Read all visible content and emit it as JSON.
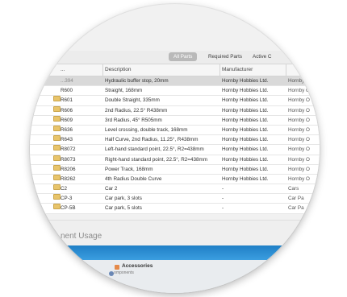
{
  "toolbar": {
    "segments": [
      {
        "label": "All Parts",
        "active": true
      },
      {
        "label": "Required Parts",
        "active": false
      },
      {
        "label": "Active C",
        "active": false
      }
    ]
  },
  "table": {
    "headers": [
      "...",
      "Description",
      "Manufacturer",
      ""
    ],
    "rows": [
      {
        "part": "...394",
        "description": "Hydraulic buffer stop, 20mm",
        "manufacturer": "Hornby Hobbies Ltd.",
        "category": "Hornby",
        "selected": true,
        "folder": false
      },
      {
        "part": "R600",
        "description": "Straight, 168mm",
        "manufacturer": "Hornby Hobbies Ltd.",
        "category": "Hornby O",
        "selected": false,
        "folder": false
      },
      {
        "part": "R601",
        "description": "Double Straight, 335mm",
        "manufacturer": "Hornby Hobbies Ltd.",
        "category": "Hornby O",
        "selected": false,
        "folder": true
      },
      {
        "part": "R606",
        "description": "2nd Radius, 22.5° R438mm",
        "manufacturer": "Hornby Hobbies Ltd.",
        "category": "Hornby O",
        "selected": false,
        "folder": true
      },
      {
        "part": "R609",
        "description": "3rd Radius, 45° R505mm",
        "manufacturer": "Hornby Hobbies Ltd.",
        "category": "Hornby O",
        "selected": false,
        "folder": true
      },
      {
        "part": "R636",
        "description": "Level crossing, double track, 168mm",
        "manufacturer": "Hornby Hobbies Ltd.",
        "category": "Hornby O",
        "selected": false,
        "folder": true
      },
      {
        "part": "R643",
        "description": "Half Curve, 2nd Radius, 11.25°, R438mm",
        "manufacturer": "Hornby Hobbies Ltd.",
        "category": "Hornby O",
        "selected": false,
        "folder": true
      },
      {
        "part": "R8072",
        "description": "Left-hand standard point, 22.5°, R2=438mm",
        "manufacturer": "Hornby Hobbies Ltd.",
        "category": "Hornby O",
        "selected": false,
        "folder": true
      },
      {
        "part": "R8073",
        "description": "Right-hand standard point, 22.5°, R2=438mm",
        "manufacturer": "Hornby Hobbies Ltd.",
        "category": "Hornby O",
        "selected": false,
        "folder": true
      },
      {
        "part": "R8206",
        "description": "Power Track, 168mm",
        "manufacturer": "Hornby Hobbies Ltd.",
        "category": "Hornby O",
        "selected": false,
        "folder": true
      },
      {
        "part": "R8262",
        "description": "4th Radius Double Curve",
        "manufacturer": "Hornby Hobbies Ltd.",
        "category": "Hornby O",
        "selected": false,
        "folder": true
      },
      {
        "part": "C2",
        "description": "Car 2",
        "manufacturer": "-",
        "category": "Cars",
        "selected": false,
        "folder": true
      },
      {
        "part": "CP-3",
        "description": "Car park, 3 slots",
        "manufacturer": "-",
        "category": "Car Pa",
        "selected": false,
        "folder": true
      },
      {
        "part": "CP-5B",
        "description": "Car park, 5 slots",
        "manufacturer": "-",
        "category": "Car Pa",
        "selected": false,
        "folder": true
      }
    ]
  },
  "usage": {
    "title": "nent Usage"
  },
  "bottom_panel": {
    "accessories_label": "Accessories",
    "accessories_sub": "...omponents"
  },
  "colors": {
    "selected_row": "#d9d9d9",
    "band_blue": "#2a8fd4",
    "folder": "#e8c46a"
  }
}
